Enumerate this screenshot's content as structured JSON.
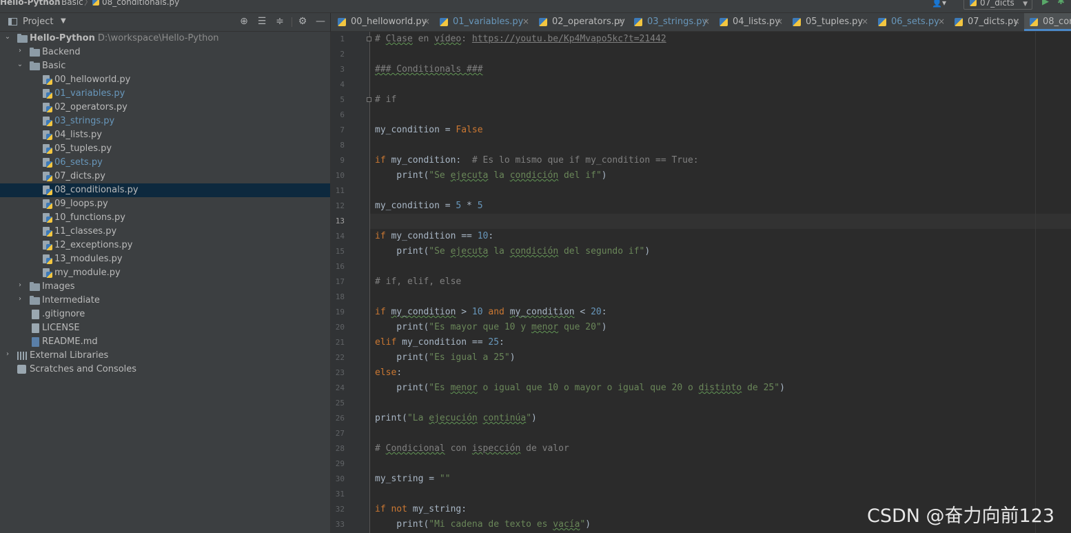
{
  "breadcrumb": {
    "project": "Hello-Python",
    "folder": "Basic",
    "file": "08_conditionals.py"
  },
  "run_config": "07_dicts",
  "panel": {
    "title": "Project"
  },
  "tree": {
    "root": {
      "name": "Hello-Python",
      "path": "D:\\workspace\\Hello-Python"
    },
    "backend": "Backend",
    "basic": "Basic",
    "files": [
      {
        "name": "00_helloworld.py",
        "modified": false
      },
      {
        "name": "01_variables.py",
        "modified": true
      },
      {
        "name": "02_operators.py",
        "modified": false
      },
      {
        "name": "03_strings.py",
        "modified": true
      },
      {
        "name": "04_lists.py",
        "modified": false
      },
      {
        "name": "05_tuples.py",
        "modified": false
      },
      {
        "name": "06_sets.py",
        "modified": true
      },
      {
        "name": "07_dicts.py",
        "modified": false
      },
      {
        "name": "08_conditionals.py",
        "modified": false,
        "selected": true
      },
      {
        "name": "09_loops.py",
        "modified": false
      },
      {
        "name": "10_functions.py",
        "modified": false
      },
      {
        "name": "11_classes.py",
        "modified": false
      },
      {
        "name": "12_exceptions.py",
        "modified": false
      },
      {
        "name": "13_modules.py",
        "modified": false
      },
      {
        "name": "my_module.py",
        "modified": false
      }
    ],
    "images": "Images",
    "intermediate": "Intermediate",
    "gitignore": ".gitignore",
    "license": "LICENSE",
    "readme": "README.md",
    "external": "External Libraries",
    "scratches": "Scratches and Consoles"
  },
  "tabs": [
    {
      "label": "00_helloworld.py",
      "modified": false
    },
    {
      "label": "01_variables.py",
      "modified": true
    },
    {
      "label": "02_operators.py",
      "modified": false
    },
    {
      "label": "03_strings.py",
      "modified": true
    },
    {
      "label": "04_lists.py",
      "modified": false
    },
    {
      "label": "05_tuples.py",
      "modified": false
    },
    {
      "label": "06_sets.py",
      "modified": true
    },
    {
      "label": "07_dicts.py",
      "modified": false
    },
    {
      "label": "08_con",
      "modified": false,
      "active": true
    }
  ],
  "editor": {
    "current_line": 13,
    "line_numbers": [
      "1",
      "2",
      "3",
      "4",
      "5",
      "6",
      "7",
      "8",
      "9",
      "10",
      "11",
      "12",
      "13",
      "14",
      "15",
      "16",
      "17",
      "18",
      "19",
      "20",
      "21",
      "22",
      "23",
      "24",
      "25",
      "26",
      "27",
      "28",
      "29",
      "30",
      "31",
      "32",
      "33"
    ],
    "code": {
      "l1_comment": "# ",
      "l1_w1": "Clase",
      "l1_mid": " en ",
      "l1_w2": "vídeo",
      "l1_colon": ": ",
      "l1_url": "https://youtu.be/Kp4Mvapo5kc?t=21442",
      "l3": "### Conditionals ###",
      "l5": "# if",
      "l7_var": "my_condition = ",
      "l7_val": "False",
      "l9_kw": "if",
      "l9_rest": " my_condition:  ",
      "l9_cmt": "# Es lo mismo que if my_condition == True:",
      "l10_fn": "    print(",
      "l10_s1": "\"Se ",
      "l10_w1": "ejecuta",
      "l10_s2": " la ",
      "l10_w2": "condición",
      "l10_s3": " del if\"",
      "l10_end": ")",
      "l12_var": "my_condition = ",
      "l12_n1": "5",
      "l12_op": " * ",
      "l12_n2": "5",
      "l14_kw": "if",
      "l14_rest": " my_condition == ",
      "l14_num": "10",
      "l14_end": ":",
      "l15_fn": "    print(",
      "l15_s1": "\"Se ",
      "l15_w1": "ejecuta",
      "l15_s2": " la ",
      "l15_w2": "condición",
      "l15_s3": " del segundo if\"",
      "l15_end": ")",
      "l17": "# if, elif, else",
      "l19_kw": "if",
      "l19_sp": " ",
      "l19_v1": "my_condition",
      "l19_op1": " > ",
      "l19_n1": "10",
      "l19_sp2": " ",
      "l19_and": "and",
      "l19_sp3": " ",
      "l19_v2": "my_condition",
      "l19_op2": " < ",
      "l19_n2": "20",
      "l19_end": ":",
      "l20_fn": "    print(",
      "l20_s1": "\"Es mayor que 10 y ",
      "l20_w1": "menor",
      "l20_s2": " que 20\"",
      "l20_end": ")",
      "l21_kw": "elif",
      "l21_rest": " my_condition == ",
      "l21_num": "25",
      "l21_end": ":",
      "l22_fn": "    print(",
      "l22_str": "\"Es igual a 25\"",
      "l22_end": ")",
      "l23_kw": "else",
      "l23_end": ":",
      "l24_fn": "    print(",
      "l24_s1": "\"Es ",
      "l24_w1": "menor",
      "l24_s2": " o igual que 10 o mayor o igual que 20 o ",
      "l24_w2": "distinto",
      "l24_s3": " de 25\"",
      "l24_end": ")",
      "l26_fn": "print(",
      "l26_s1": "\"La ",
      "l26_w1": "ejecución",
      "l26_s2": " ",
      "l26_w2": "continúa",
      "l26_s3": "\"",
      "l26_end": ")",
      "l28_c1": "# ",
      "l28_w1": "Condicional",
      "l28_c2": " con ",
      "l28_w2": "ispección",
      "l28_c3": " de valor",
      "l30_var": "my_string = ",
      "l30_str": "\"\"",
      "l32_kw": "if",
      "l32_sp": " ",
      "l32_not": "not",
      "l32_rest": " my_string:",
      "l33_fn": "    print(",
      "l33_s1": "\"Mi cadena de texto es ",
      "l33_w1": "vacía",
      "l33_s2": "\"",
      "l33_end": ")"
    }
  },
  "watermark": "CSDN @奋力向前123",
  "colors": {
    "background": "#2b2b2b",
    "panel": "#3c3f41",
    "keyword": "#cc7832",
    "string": "#6a8759",
    "number": "#6897bb",
    "comment": "#808080",
    "selection": "#0d293e",
    "modified_file": "#6897bb"
  }
}
